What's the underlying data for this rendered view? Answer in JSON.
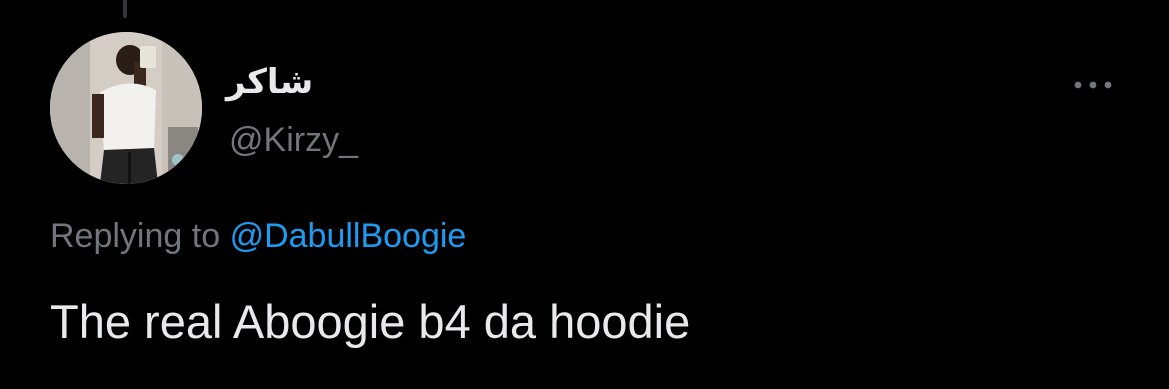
{
  "tweet": {
    "author": {
      "display_name": "شاكر",
      "handle": "@Kirzy_"
    },
    "reply": {
      "prefix": "Replying to",
      "handle": "@DabullBoogie"
    },
    "text": "The real Aboogie b4 da hoodie"
  },
  "icons": {
    "more": "more-horizontal-icon"
  },
  "colors": {
    "background": "#000000",
    "primary_text": "#e7e9ea",
    "secondary_text": "#71767b",
    "link": "#1d9bf0"
  }
}
